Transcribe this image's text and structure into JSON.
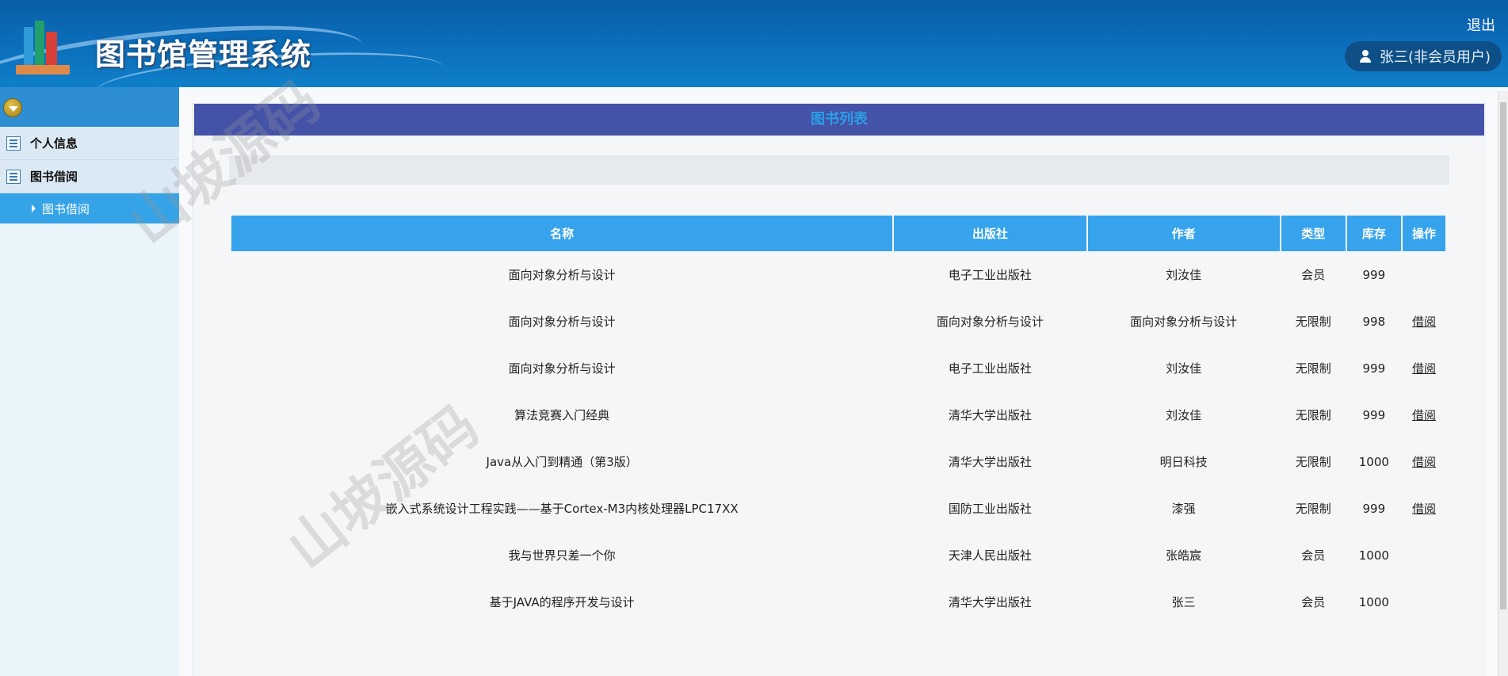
{
  "header": {
    "title": "图书馆管理系统",
    "logout": "退出",
    "user": "张三(非会员用户)"
  },
  "sidebar": {
    "items": [
      {
        "label": "个人信息"
      },
      {
        "label": "图书借阅"
      }
    ],
    "submenu": [
      {
        "label": "图书借阅"
      }
    ]
  },
  "panel": {
    "title": "图书列表"
  },
  "table": {
    "headers": [
      "名称",
      "出版社",
      "作者",
      "类型",
      "库存",
      "操作"
    ],
    "rows": [
      {
        "name": "面向对象分析与设计",
        "publisher": "电子工业出版社",
        "author": "刘汝佳",
        "type": "会员",
        "stock": "999",
        "action": ""
      },
      {
        "name": "面向对象分析与设计",
        "publisher": "面向对象分析与设计",
        "author": "面向对象分析与设计",
        "type": "无限制",
        "stock": "998",
        "action": "借阅"
      },
      {
        "name": "面向对象分析与设计",
        "publisher": "电子工业出版社",
        "author": "刘汝佳",
        "type": "无限制",
        "stock": "999",
        "action": "借阅"
      },
      {
        "name": "算法竞赛入门经典",
        "publisher": "清华大学出版社",
        "author": "刘汝佳",
        "type": "无限制",
        "stock": "999",
        "action": "借阅"
      },
      {
        "name": "Java从入门到精通（第3版）",
        "publisher": "清华大学出版社",
        "author": "明日科技",
        "type": "无限制",
        "stock": "1000",
        "action": "借阅"
      },
      {
        "name": "嵌入式系统设计工程实践——基于Cortex-M3内核处理器LPC17XX",
        "publisher": "国防工业出版社",
        "author": "漆强",
        "type": "无限制",
        "stock": "999",
        "action": "借阅"
      },
      {
        "name": "我与世界只差一个你",
        "publisher": "天津人民出版社",
        "author": "张皓宸",
        "type": "会员",
        "stock": "1000",
        "action": ""
      },
      {
        "name": "基于JAVA的程序开发与设计",
        "publisher": "清华大学出版社",
        "author": "张三",
        "type": "会员",
        "stock": "1000",
        "action": ""
      }
    ]
  },
  "watermark": "山坡源码"
}
